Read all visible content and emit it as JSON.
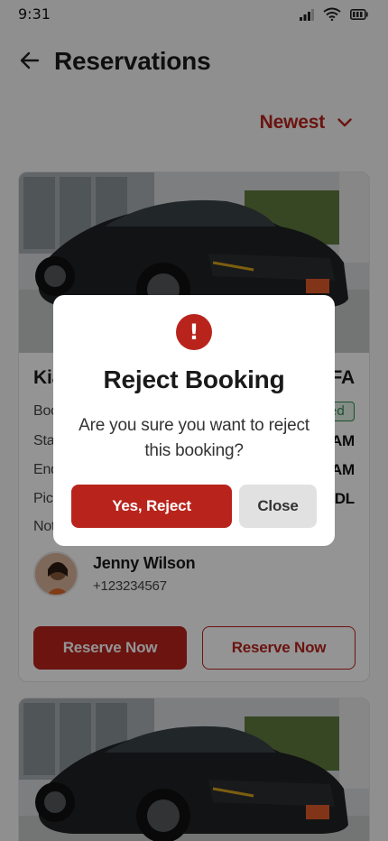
{
  "status_bar": {
    "time": "9:31"
  },
  "header": {
    "title": "Reservations"
  },
  "sort": {
    "label": "Newest"
  },
  "card": {
    "car_name": "Kia",
    "plate": "CFA",
    "fields": [
      {
        "label": "Boo",
        "value": ""
      },
      {
        "label": "Star",
        "value": "AM"
      },
      {
        "label": "End",
        "value": "AM"
      },
      {
        "label": "Pick",
        "value": "ADL"
      },
      {
        "label": "Not",
        "value": ""
      }
    ],
    "status": "ed",
    "customer": {
      "name": "Jenny Wilson",
      "phone": "+123234567"
    },
    "buttons": {
      "primary": "Reserve Now",
      "secondary": "Reserve Now"
    }
  },
  "modal": {
    "title": "Reject Booking",
    "message": "Are you sure you want to reject this booking?",
    "confirm": "Yes, Reject",
    "close": "Close"
  },
  "colors": {
    "accent": "#b8241c",
    "success": "#2e8b4a",
    "overlay": "rgba(0,0,0,0.42)"
  },
  "icons": [
    "back-arrow-icon",
    "chevron-down-icon",
    "signal-icon",
    "wifi-icon",
    "battery-icon",
    "alert-icon"
  ]
}
